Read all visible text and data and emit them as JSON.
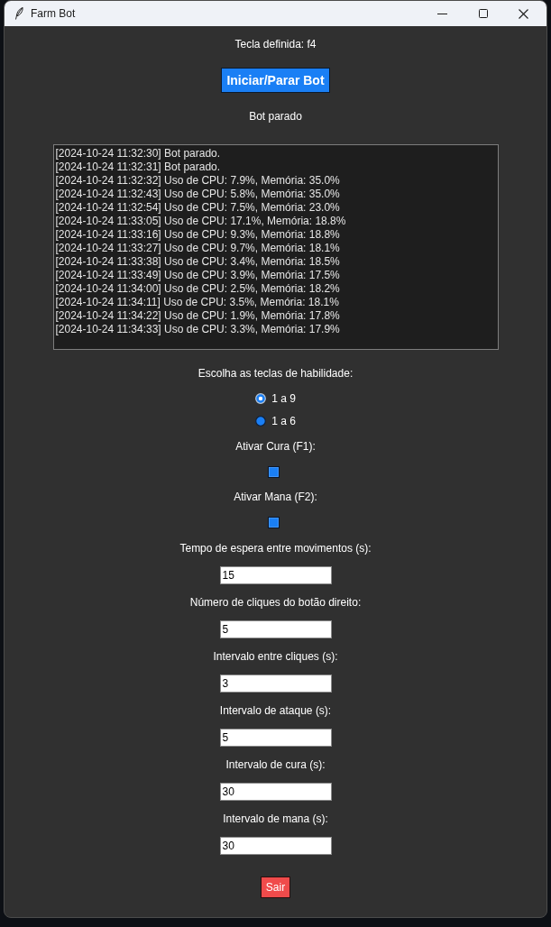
{
  "window": {
    "title": "Farm Bot"
  },
  "hotkey_label": "Tecla definida: f4",
  "toggle_button": "Iniciar/Parar Bot",
  "status": "Bot parado",
  "log": [
    "[2024-10-24 11:32:30] Bot parado.",
    "[2024-10-24 11:32:31] Bot parado.",
    "[2024-10-24 11:32:32] Uso de CPU: 7.9%, Memória: 35.0%",
    "[2024-10-24 11:32:43] Uso de CPU: 5.8%, Memória: 35.0%",
    "[2024-10-24 11:32:54] Uso de CPU: 7.5%, Memória: 23.0%",
    "[2024-10-24 11:33:05] Uso de CPU: 17.1%, Memória: 18.8%",
    "[2024-10-24 11:33:16] Uso de CPU: 9.3%, Memória: 18.8%",
    "[2024-10-24 11:33:27] Uso de CPU: 9.7%, Memória: 18.1%",
    "[2024-10-24 11:33:38] Uso de CPU: 3.4%, Memória: 18.5%",
    "[2024-10-24 11:33:49] Uso de CPU: 3.9%, Memória: 17.5%",
    "[2024-10-24 11:34:00] Uso de CPU: 2.5%, Memória: 18.2%",
    "[2024-10-24 11:34:11] Uso de CPU: 3.5%, Memória: 18.1%",
    "[2024-10-24 11:34:22] Uso de CPU: 1.9%, Memória: 17.8%",
    "[2024-10-24 11:34:33] Uso de CPU: 3.3%, Memória: 17.9%"
  ],
  "skill_keys": {
    "label": "Escolha as teclas de habilidade:",
    "options": [
      {
        "label": "1 a 9",
        "selected": true
      },
      {
        "label": "1 a 6",
        "selected": false
      }
    ]
  },
  "checkboxes": [
    {
      "label": "Ativar Cura (F1):",
      "checked": false
    },
    {
      "label": "Ativar Mana (F2):",
      "checked": false
    }
  ],
  "fields": [
    {
      "label": "Tempo de espera entre movimentos (s):",
      "value": "15"
    },
    {
      "label": "Número de cliques do botão direito:",
      "value": "5"
    },
    {
      "label": "Intervalo entre cliques (s):",
      "value": "3"
    },
    {
      "label": "Intervalo de ataque (s):",
      "value": "5"
    },
    {
      "label": "Intervalo de cura (s):",
      "value": "30"
    },
    {
      "label": "Intervalo de mana (s):",
      "value": "30"
    }
  ],
  "exit_button": "Sair"
}
